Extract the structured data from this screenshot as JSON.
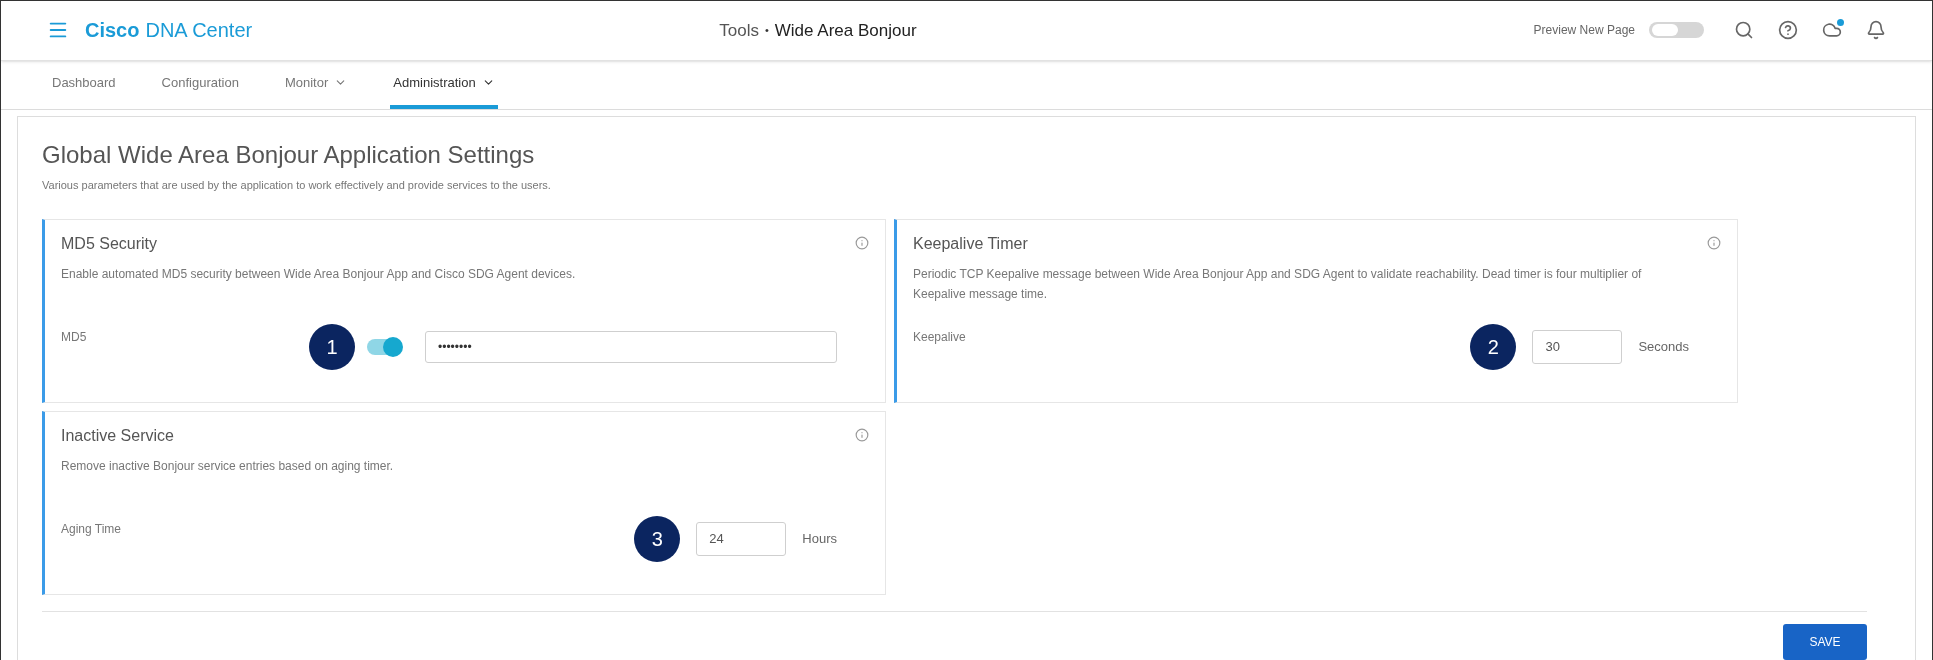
{
  "header": {
    "brand_bold": "Cisco",
    "brand_rest": "DNA Center",
    "breadcrumb_parent": "Tools",
    "breadcrumb_separator": "•",
    "breadcrumb_current": "Wide Area Bonjour",
    "preview_label": "Preview New Page",
    "preview_on": false,
    "cloud_notification": true
  },
  "nav": [
    {
      "label": "Dashboard",
      "selected": false,
      "dropdown": false
    },
    {
      "label": "Configuration",
      "selected": false,
      "dropdown": false
    },
    {
      "label": "Monitor",
      "selected": false,
      "dropdown": true
    },
    {
      "label": "Administration",
      "selected": true,
      "dropdown": true
    }
  ],
  "page": {
    "title": "Global Wide Area Bonjour Application Settings",
    "subtitle": "Various parameters that are used by the application to work effectively and provide services to the users."
  },
  "cards": [
    {
      "kind": "toggle-password",
      "title": "MD5 Security",
      "description": "Enable automated MD5 security between Wide Area Bonjour App and Cisco SDG Agent devices.",
      "field_label": "MD5",
      "callout": "1",
      "on": true,
      "value": "••••••••"
    },
    {
      "kind": "number-unit",
      "title": "Keepalive Timer",
      "description": "Periodic TCP Keepalive message between Wide Area Bonjour App and SDG Agent to validate reachability. Dead timer is four multiplier of Keepalive message time.",
      "field_label": "Keepalive",
      "callout": "2",
      "value": "30",
      "unit": "Seconds"
    },
    {
      "kind": "number-unit",
      "title": "Inactive Service",
      "description": "Remove inactive Bonjour service entries based on aging timer.",
      "field_label": "Aging Time",
      "callout": "3",
      "value": "24",
      "unit": "Hours"
    }
  ],
  "save_button": "SAVE"
}
